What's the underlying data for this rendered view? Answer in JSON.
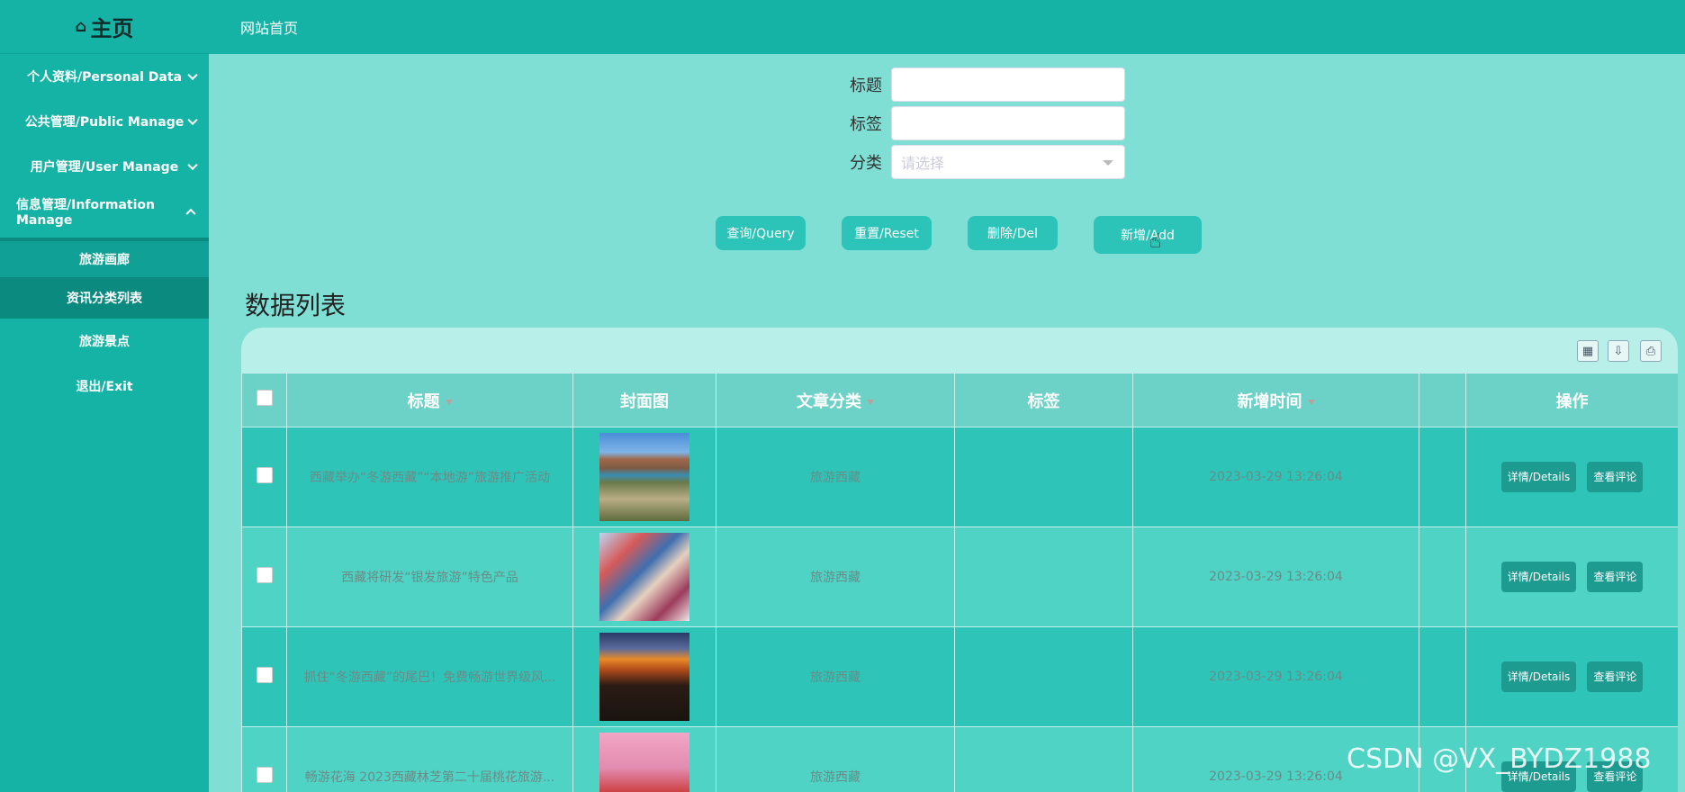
{
  "sidebar": {
    "brand": "主页",
    "items": [
      {
        "label": "个人资料/Personal Data"
      },
      {
        "label": "公共管理/Public Manage"
      },
      {
        "label": "用户管理/User Manage"
      },
      {
        "label": "信息管理/Information Manage"
      }
    ],
    "subitems": [
      {
        "label": "旅游画廊"
      },
      {
        "label": "资讯分类列表"
      }
    ],
    "plain": [
      {
        "label": "旅游景点"
      },
      {
        "label": "退出/Exit"
      }
    ]
  },
  "header": {
    "title": "网站首页"
  },
  "search": {
    "title_label": "标题",
    "tag_label": "标签",
    "category_label": "分类",
    "category_placeholder": "请选择"
  },
  "buttons": {
    "query": "查询/Query",
    "reset": "重置/Reset",
    "delete": "删除/Del",
    "add": "新增/Add"
  },
  "list": {
    "title": "数据列表",
    "columns": [
      "标题",
      "封面图",
      "文章分类",
      "标签",
      "新增时间",
      "操作"
    ],
    "rows": [
      {
        "title": "西藏举办“冬游西藏”“本地游”旅游推广活动",
        "category": "旅游西藏",
        "tag": "",
        "time": "2023-03-29 13:26:04"
      },
      {
        "title": "西藏将研发“银发旅游”特色产品",
        "category": "旅游西藏",
        "tag": "",
        "time": "2023-03-29 13:26:04"
      },
      {
        "title": "抓住“冬游西藏”的尾巴！免费畅游世界级风...",
        "category": "旅游西藏",
        "tag": "",
        "time": "2023-03-29 13:26:04"
      },
      {
        "title": "畅游花海 2023西藏林芝第二十届桃花旅游...",
        "category": "旅游西藏",
        "tag": "",
        "time": "2023-03-29 13:26:04"
      }
    ],
    "action_details": "详情/Details",
    "action_comments": "查看评论"
  },
  "watermark": "CSDN @VX_BYDZ1988"
}
